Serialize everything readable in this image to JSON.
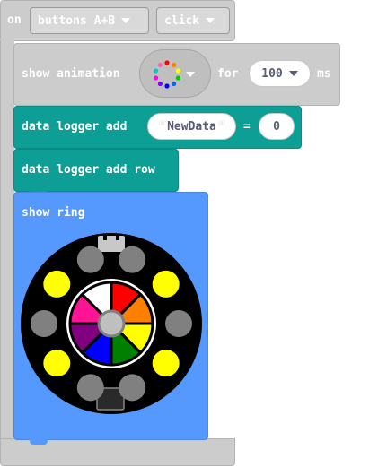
{
  "event": {
    "on_label": "on",
    "button_value": "buttons A+B",
    "action_value": "click"
  },
  "animation": {
    "show_label": "show animation",
    "for_label": "for",
    "duration_value": "100",
    "unit_label": "ms",
    "icon": "rainbow-dots-icon"
  },
  "logger_add": {
    "label": "data logger add",
    "column_value": "NewData",
    "eq_label": "=",
    "number_value": "0"
  },
  "logger_row": {
    "label": "data logger add row"
  },
  "ring": {
    "label": "show ring",
    "outer_led_colors": [
      "#808080",
      "#808080",
      "#ffff00",
      "#808080",
      "#ffff00",
      "#808080",
      "#808080",
      "#ffff00",
      "#808080",
      "#ffff00"
    ],
    "wheel_colors": [
      "#ff0000",
      "#ff8000",
      "#ffff00",
      "#008000",
      "#0000ff",
      "#800080",
      "#ff1493",
      "#ffffff"
    ],
    "center_color": "#bfbfbf"
  },
  "colors": {
    "event_block": "#cccccc",
    "logger_block": "#0d9e96",
    "ring_block": "#5599ff"
  }
}
